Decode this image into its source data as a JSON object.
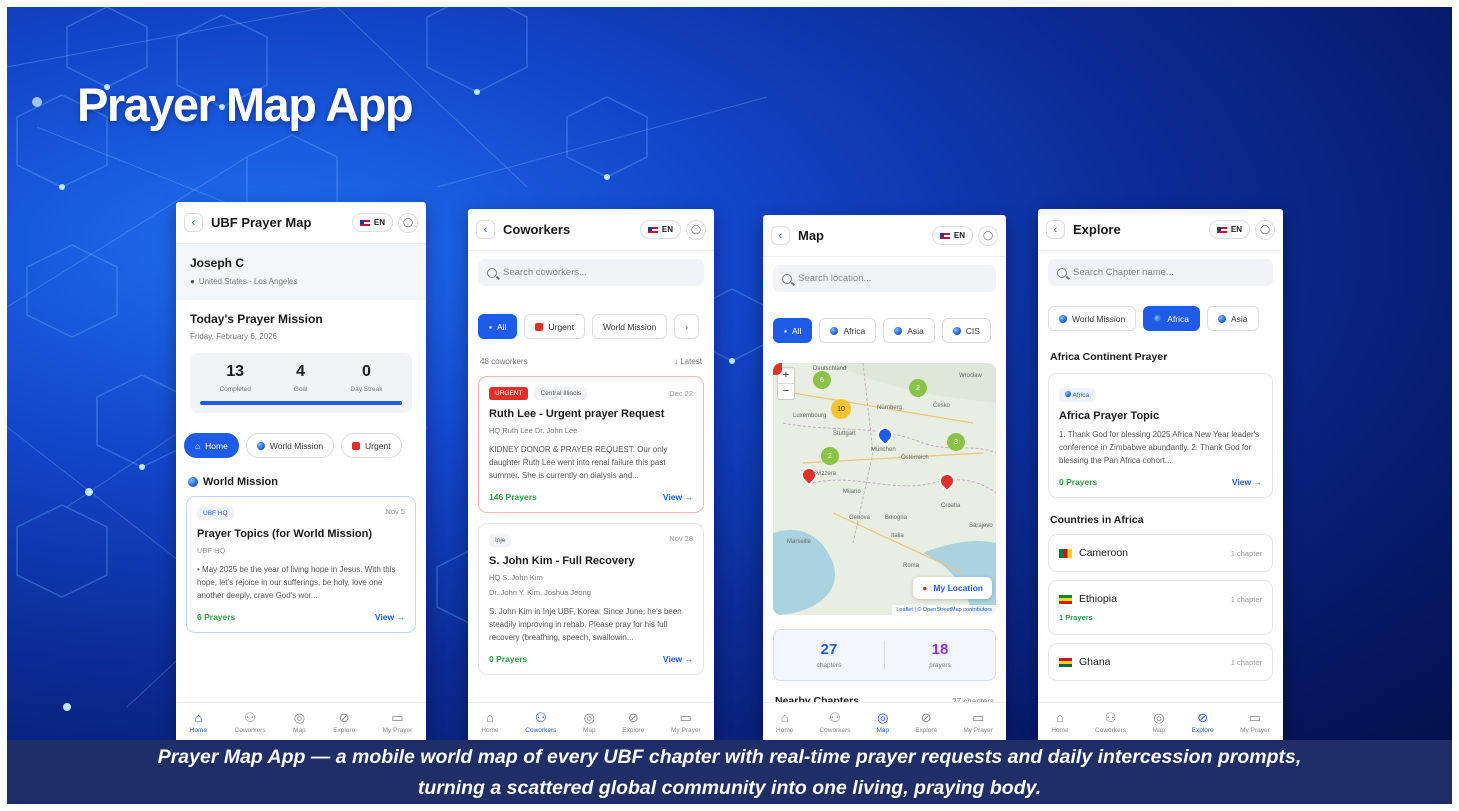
{
  "slide_title": "Prayer Map App",
  "caption_line1": "Prayer Map App — a mobile world map of every UBF chapter with real-time prayer requests and daily intercession prompts,",
  "caption_line2": "turning a scattered global community into one living, praying body.",
  "lang": "EN",
  "nav": [
    "Home",
    "Coworkers",
    "Map",
    "Explore",
    "My Prayer"
  ],
  "home": {
    "title": "UBF Prayer Map",
    "user_name": "Joseph C",
    "user_location": "United States · Los Angeles",
    "mission_title": "Today's Prayer Mission",
    "mission_date": "Friday, February 6, 2026",
    "stats": [
      {
        "value": "13",
        "label": "Completed"
      },
      {
        "value": "4",
        "label": "Goal"
      },
      {
        "value": "0",
        "label": "Day Streak"
      }
    ],
    "chips": [
      "Home",
      "World Mission",
      "Urgent"
    ],
    "section": "World Mission",
    "card": {
      "tag": "UBF HQ",
      "date": "Nov 5",
      "title": "Prayer Topics (for World Mission)",
      "org": "UBF HQ",
      "body": "• May 2025 be the year of living hope in Jesus. With this hope, let's rejoice in our sufferings, be holy, love one another deeply, crave God's wor...",
      "prayers": "6 Prayers",
      "view": "View →"
    }
  },
  "coworkers": {
    "title": "Coworkers",
    "search": "Search coworkers...",
    "chips": [
      "All",
      "Urgent",
      "World Mission"
    ],
    "count": "48 coworkers",
    "sort": "↓ Latest",
    "card1": {
      "badge": "URGENT",
      "tag": "Central Illinois",
      "date": "Dec 22",
      "title": "Ruth Lee - Urgent prayer Request",
      "meta": "HQ  Ruth Lee  Dr. John Lee",
      "body": "KIDNEY DONOR & PRAYER REQUEST: Our only daughter Ruth Lee went into renal failure this past summer. She is currently on dialysis and...",
      "prayers": "146 Prayers",
      "view": "View →"
    },
    "card2": {
      "tag": "Inje",
      "date": "Nov 28",
      "title": "S. John Kim - Full Recovery",
      "meta": "HQ  S. John Kim",
      "meta2": "Dr. John Y. Kim, Joshua Jeong",
      "body": "S. John Kim in Inje UBF, Korea: Since June, he's been steadily improving in rehab. Please pray for his full recovery (breathing, speech, swallowin...",
      "prayers": "0 Prayers",
      "view": "View →"
    }
  },
  "map": {
    "title": "Map",
    "search": "Search location...",
    "chips": [
      "All",
      "Africa",
      "Asia",
      "CIS"
    ],
    "clusters": [
      "6",
      "2",
      "10",
      "2",
      "3"
    ],
    "labels": [
      "Deutschland",
      "Luxembourg",
      "Nürnberg",
      "Česko",
      "Stuttgart",
      "München",
      "Österreich",
      "Svizzera",
      "Milano",
      "Genova",
      "Bologna",
      "Croatia",
      "Marseille",
      "Italia",
      "Roma",
      "Sarajevo",
      "Wrocław"
    ],
    "my_location": "My Location",
    "attribution": "Leaflet | © OpenStreetMap contributors",
    "stats": [
      {
        "value": "27",
        "label": "chapters"
      },
      {
        "value": "18",
        "label": "prayers"
      }
    ],
    "nearby": "Nearby Chapters",
    "nearby_count": "27 chapters"
  },
  "explore": {
    "title": "Explore",
    "search": "Search Chapter name...",
    "chips": [
      "World Mission",
      "Africa",
      "Asia"
    ],
    "section": "Africa Continent Prayer",
    "card": {
      "tag": "Africa",
      "title": "Africa Prayer Topic",
      "body": "1. Thank God for blessing 2025 Africa New Year leader's conference in Zimbabwe abundantly. 2. Thank God for blessing the Pan Africa cohort...",
      "prayers": "0 Prayers",
      "view": "View →"
    },
    "countries_title": "Countries in Africa",
    "countries": [
      {
        "name": "Cameroon",
        "chapters": "1 chapter",
        "prayers": ""
      },
      {
        "name": "Ethiopia",
        "chapters": "1 chapter",
        "prayers": "1 Prayers"
      },
      {
        "name": "Ghana",
        "chapters": "1 chapter",
        "prayers": ""
      }
    ]
  },
  "colors": {
    "accent": "#1e5be6",
    "urgent": "#e0302a",
    "green": "#2e9e45",
    "caption_bg": "#1f2e67"
  }
}
